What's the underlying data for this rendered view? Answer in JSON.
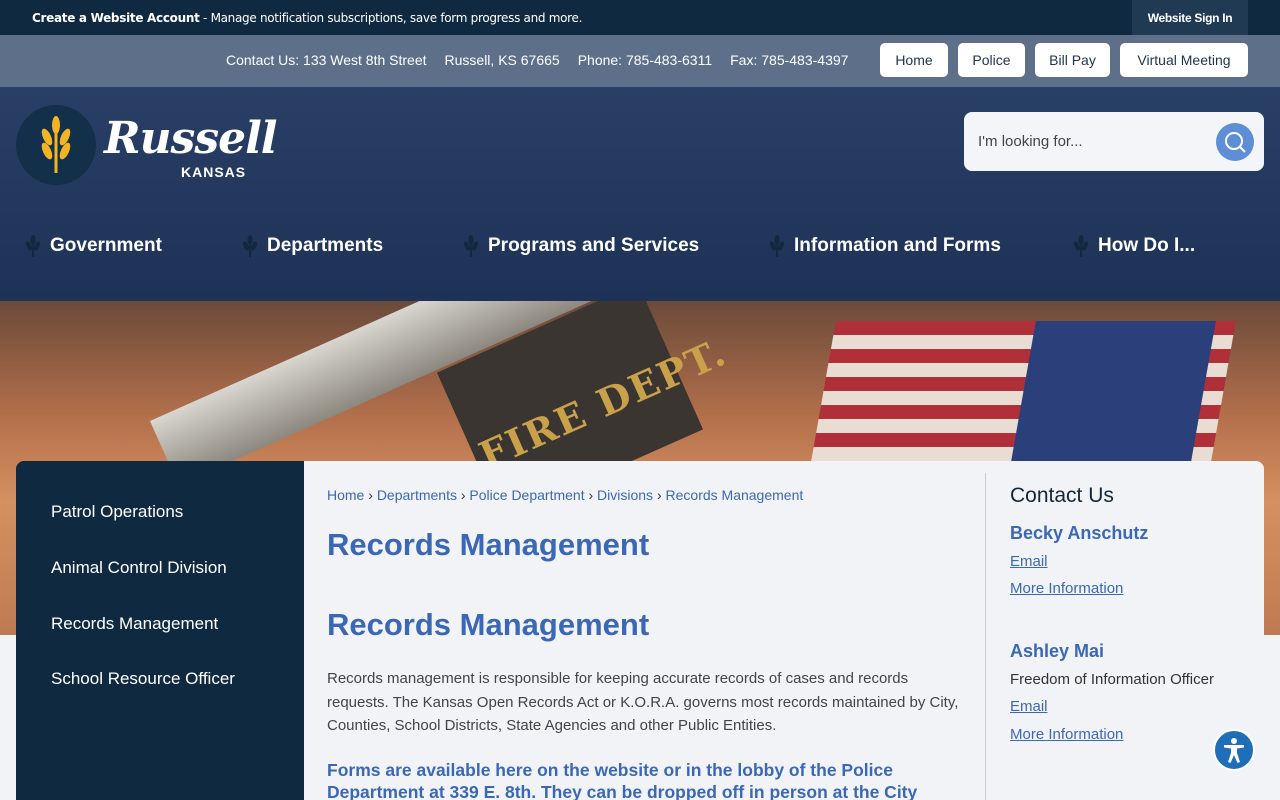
{
  "topbar": {
    "create_label": "Create a Website Account",
    "create_desc": " - Manage notification subscriptions, save form progress and more.",
    "signin_label": "Website Sign In"
  },
  "contact_bar": {
    "address": "Contact Us: 133 West 8th Street",
    "city": "Russell, KS 67665",
    "phone": "Phone: 785-483-6311",
    "fax": "Fax: 785-483-4397",
    "buttons": [
      "Home",
      "Police",
      "Bill Pay",
      "Virtual Meeting"
    ]
  },
  "header": {
    "logo_word": "Russell",
    "logo_sub": "KANSAS",
    "search_placeholder": "I'm looking for..."
  },
  "nav": {
    "items": [
      "Government",
      "Departments",
      "Programs and Services",
      "Information and Forms",
      "How Do I..."
    ]
  },
  "banner": {
    "ladder_text": "FIRE DEPT."
  },
  "sidebar": {
    "items": [
      "Patrol Operations",
      "Animal Control Division",
      "Records Management",
      "School Resource Officer"
    ]
  },
  "breadcrumb": {
    "items": [
      "Home",
      "Departments",
      "Police Department",
      "Divisions",
      "Records Management"
    ],
    "separator": "›"
  },
  "main": {
    "title": "Records Management",
    "heading": "Records Management",
    "paragraph": "Records management is responsible for keeping accurate records of cases and records requests. The Kansas Open Records Act or K.O.R.A. governs most records maintained by City, Counties, School Districts, State Agencies and other Public Entities.",
    "forms_text": "Forms are available here on the website or in the lobby of the Police Department at 339 E. 8th. They can be dropped off in person at the City"
  },
  "contact": {
    "title": "Contact Us",
    "people": [
      {
        "name": "Becky Anschutz",
        "role": "",
        "email": "Email",
        "more": "More Information"
      },
      {
        "name": "Ashley Mai",
        "role": "Freedom of Information Officer",
        "email": "Email",
        "more": "More Information"
      }
    ]
  },
  "colors": {
    "navy": "#0f2a40",
    "header_blue": "#2a3f66",
    "link_blue": "#3b68b4",
    "gold": "#f0b424"
  }
}
